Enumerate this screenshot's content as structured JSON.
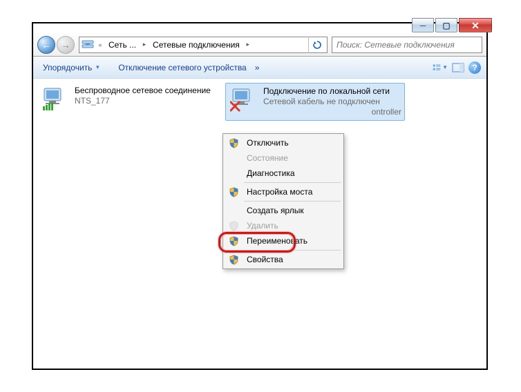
{
  "window_controls": {
    "minimize": "─",
    "maximize": "▢",
    "close": "✕"
  },
  "nav": {
    "crumbs": [
      "Сеть ...",
      "Сетевые подключения"
    ],
    "refresh_glyph": "↻",
    "search_placeholder": "Поиск: Сетевые подключения"
  },
  "toolbar": {
    "organize": "Упорядочить",
    "disable_device": "Отключение сетевого устройства",
    "more": "»",
    "help_q": "?"
  },
  "connections": [
    {
      "name": "Беспроводное сетевое соединение",
      "status": "NTS_177"
    },
    {
      "name": "Подключение по локальной сети",
      "status": "Сетевой кабель не подключен",
      "desc_tail": "ontroller"
    }
  ],
  "menu": {
    "disable": "Отключить",
    "status": "Состояние",
    "diag": "Диагностика",
    "bridge": "Настройка моста",
    "shortcut": "Создать ярлык",
    "delete": "Удалить",
    "rename": "Переименовать",
    "properties": "Свойства"
  }
}
